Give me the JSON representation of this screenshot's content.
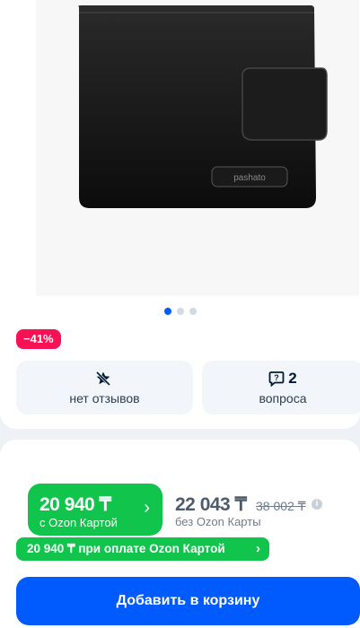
{
  "gallery": {
    "logo_text": "pashato",
    "slides": 3,
    "active_slide": 1
  },
  "discount_badge": "−41%",
  "stats": {
    "reviews": {
      "count": "",
      "label": "нет отзывов",
      "icon": "star-off-icon"
    },
    "questions": {
      "count": "2",
      "label": "вопроса",
      "icon": "question-icon"
    }
  },
  "price": {
    "ozon_card_price": "20 940 ₸",
    "ozon_card_label": "с Ozon Картой",
    "regular_price": "22 043 ₸",
    "old_price": "38 002 ₸",
    "regular_label": "без Ozon Карты",
    "banner": "20 940 ₸ при оплате Ozon Картой"
  },
  "cart_button": "Добавить в корзину",
  "colors": {
    "accent": "#005bff",
    "green": "#10c44c",
    "badge": "#f91155"
  }
}
